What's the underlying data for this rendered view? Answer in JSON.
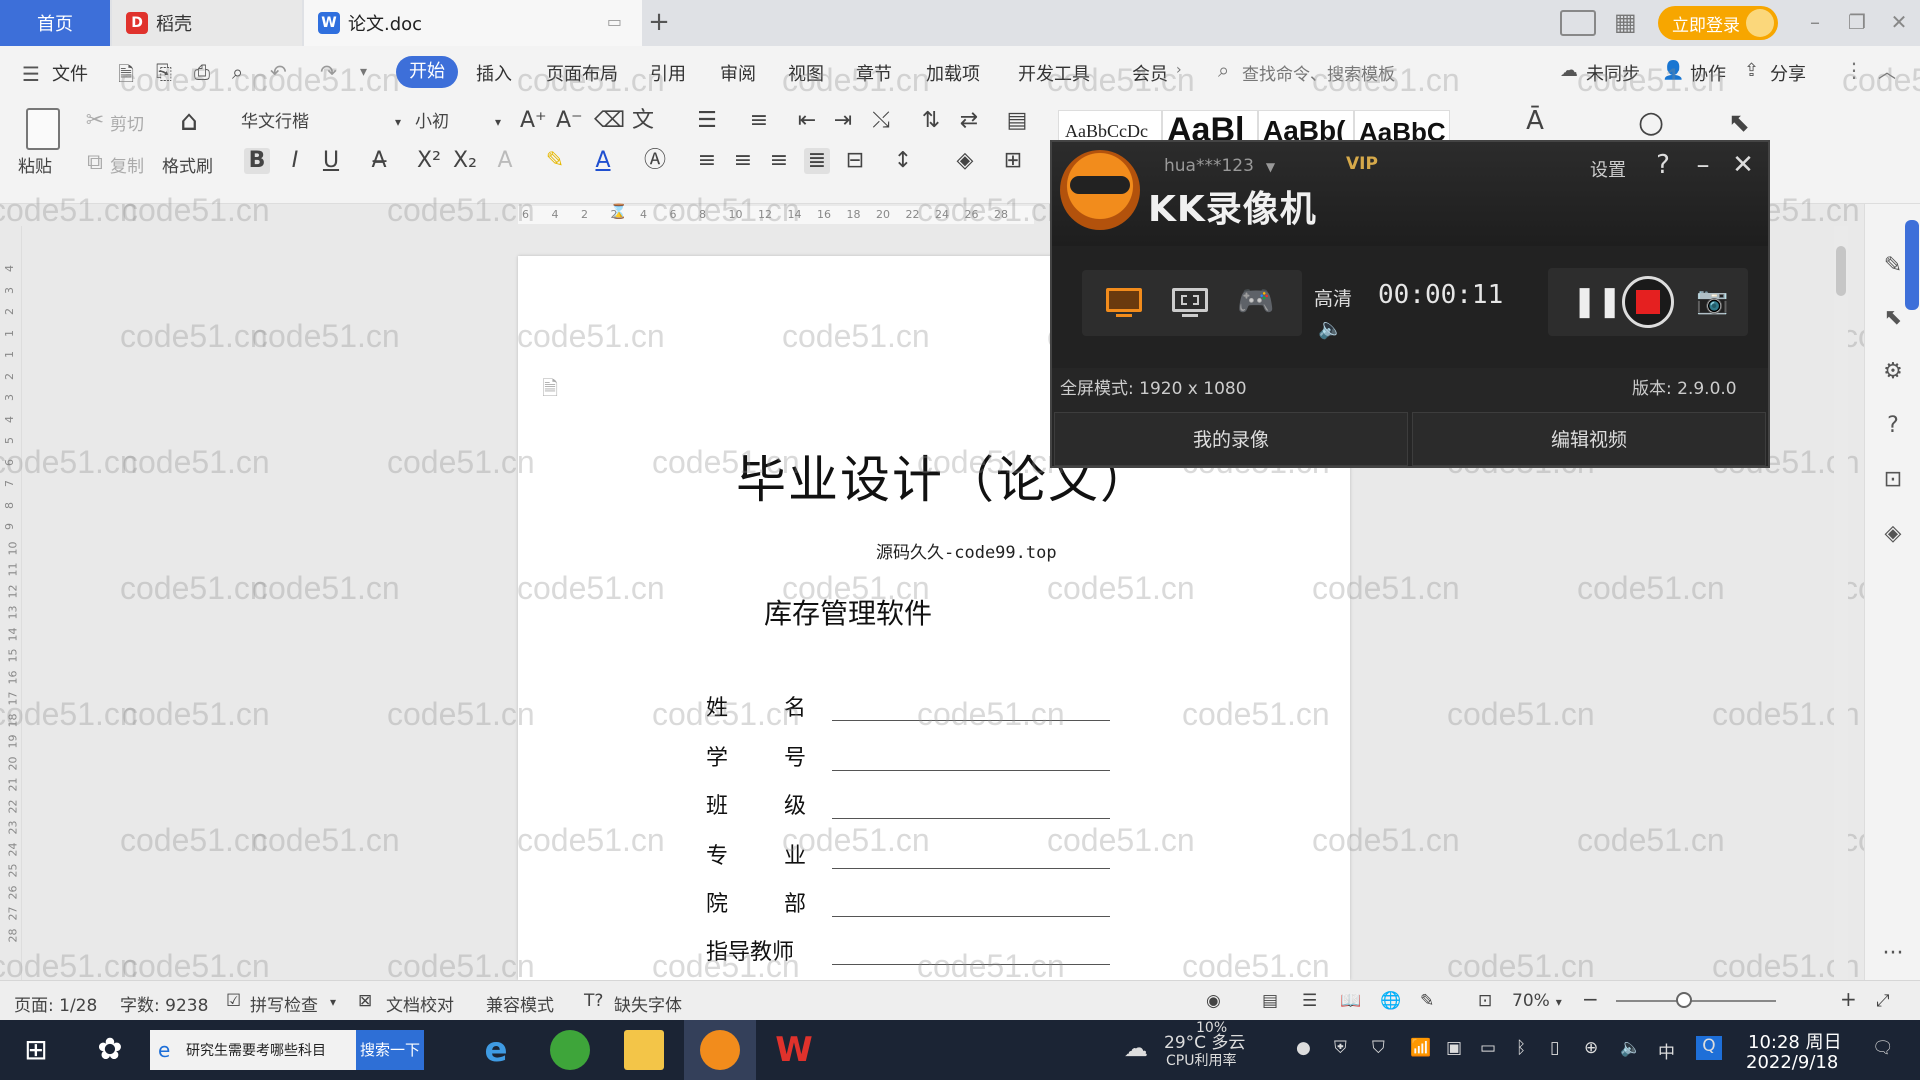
{
  "tabs": {
    "home": "首页",
    "daoke": "稻壳",
    "document": "论文.doc",
    "login": "立即登录"
  },
  "menu": {
    "file": "文件",
    "items": [
      "开始",
      "插入",
      "页面布局",
      "引用",
      "审阅",
      "视图",
      "章节",
      "加载项",
      "开发工具",
      "会员"
    ],
    "search_command": "查找命令、搜索模板",
    "sync": "未同步",
    "collab": "协作",
    "share": "分享"
  },
  "ribbon": {
    "paste": "粘贴",
    "cut": "剪切",
    "copy": "复制",
    "format_painter": "格式刷",
    "font_name": "华文行楷",
    "font_size": "小初",
    "style_samples": [
      "AaBbCcDc",
      "AaBl",
      "AaBb(",
      "AaBbC"
    ]
  },
  "ruler_numbers": [
    "6",
    "4",
    "2",
    "2",
    "4",
    "6",
    "8",
    "10",
    "12",
    "14",
    "16",
    "18",
    "20",
    "22",
    "24",
    "26",
    "28"
  ],
  "vruler_numbers": [
    "4",
    "3",
    "2",
    "1",
    "1",
    "2",
    "3",
    "4",
    "5",
    "6",
    "7",
    "8",
    "9",
    "10",
    "11",
    "12",
    "13",
    "14",
    "15",
    "16",
    "17",
    "18",
    "19",
    "20",
    "21",
    "22",
    "23",
    "24",
    "25",
    "26",
    "27",
    "28"
  ],
  "document": {
    "title": "毕业设计（论文）",
    "source": "源码久久-code99.top",
    "subtitle": "库存管理软件",
    "fields": [
      {
        "label_a": "姓",
        "label_b": "名"
      },
      {
        "label_a": "学",
        "label_b": "号"
      },
      {
        "label_a": "班",
        "label_b": "级"
      },
      {
        "label_a": "专",
        "label_b": "业"
      },
      {
        "label_a": "院",
        "label_b": "部"
      },
      {
        "label_a": "指导教师",
        "label_b": ""
      }
    ]
  },
  "watermark": "code51.cn",
  "recorder": {
    "name": "KK录像机",
    "user": "hua***123",
    "vip": "VIP",
    "settings": "设置",
    "quality": "高清",
    "time": "00:00:11",
    "mode_label": "全屏模式: 1920 x 1080",
    "version": "版本: 2.9.0.0",
    "my_recordings": "我的录像",
    "edit_video": "编辑视频"
  },
  "statusbar": {
    "page": "页面: 1/28",
    "word_count": "字数: 9238",
    "spell_check": "拼写检查",
    "doc_proof": "文档校对",
    "compat_mode": "兼容模式",
    "missing_font": "缺失字体",
    "zoom": "70%"
  },
  "taskbar": {
    "search_text": "研究生需要考哪些科目",
    "search_button": "搜索一下",
    "weather": "29°C 多云",
    "cpu_pct": "10%",
    "cpu_label": "CPU利用率",
    "ime": "中",
    "time": "10:28 周日",
    "date": "2022/9/18"
  },
  "colors": {
    "accent": "#3d6fd9",
    "login": "#f7a600",
    "record": "#e52020"
  }
}
